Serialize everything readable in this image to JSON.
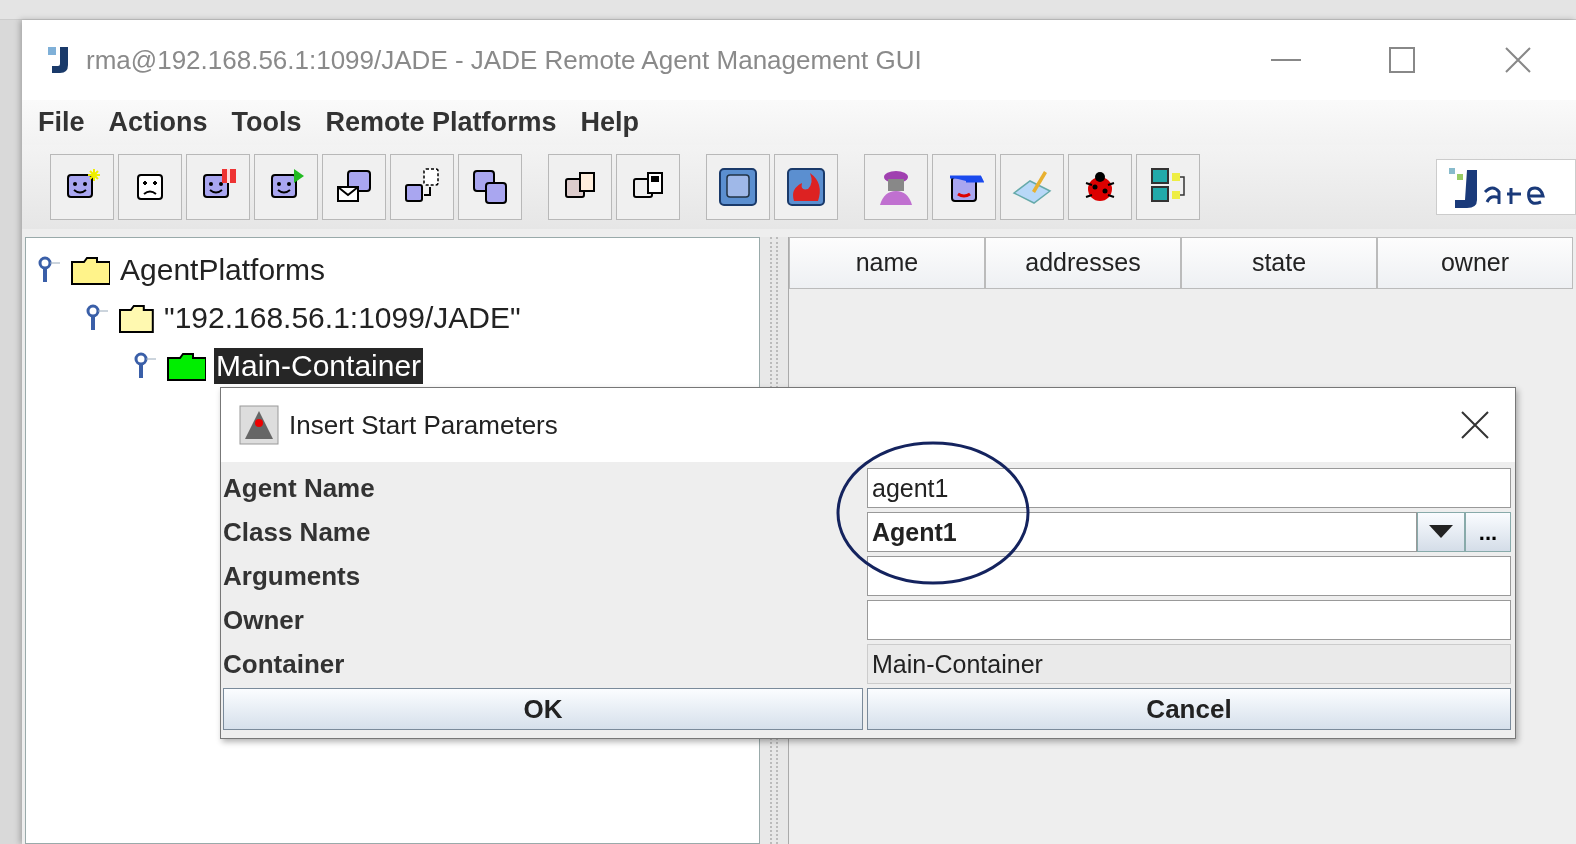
{
  "window": {
    "title": "rma@192.168.56.1:1099/JADE - JADE Remote Agent Management GUI"
  },
  "menu": [
    "File",
    "Actions",
    "Tools",
    "Remote Platforms",
    "Help"
  ],
  "tree": [
    {
      "label": "AgentPlatforms",
      "kind": "root",
      "expanded": true,
      "selected": false,
      "children": [
        {
          "label": "\"192.168.56.1:1099/JADE\"",
          "kind": "platform",
          "expanded": true,
          "selected": false,
          "children": [
            {
              "label": "Main-Container",
              "kind": "container",
              "expanded": true,
              "selected": true
            }
          ]
        }
      ]
    }
  ],
  "table": {
    "columns": [
      "name",
      "addresses",
      "state",
      "owner"
    ]
  },
  "dialog": {
    "title": "Insert Start Parameters",
    "fields": [
      {
        "label": "Agent Name",
        "kind": "text",
        "value": "agent1"
      },
      {
        "label": "Class Name",
        "kind": "combo",
        "value": "Agent1",
        "browse": "..."
      },
      {
        "label": "Arguments",
        "kind": "text"
      },
      {
        "label": "Owner",
        "kind": "text"
      },
      {
        "label": "Container",
        "kind": "readonly",
        "value": "Main-Container"
      }
    ],
    "buttons": [
      "OK",
      "Cancel"
    ]
  }
}
